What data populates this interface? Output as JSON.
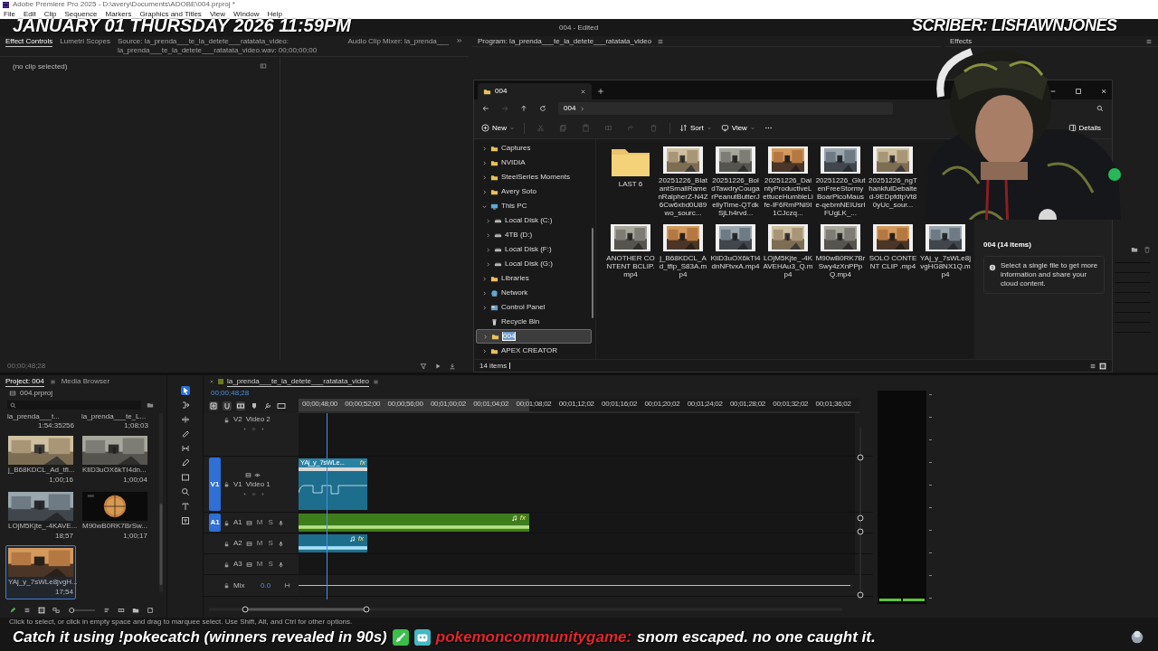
{
  "title_bar": {
    "title": "Adobe Premiere Pro 2025 - D:\\avery\\Documents\\ADOBE\\004.prproj *"
  },
  "menu": [
    "File",
    "Edit",
    "Clip",
    "Sequence",
    "Markers",
    "Graphics and Titles",
    "View",
    "Window",
    "Help"
  ],
  "overlay": {
    "date": "JANUARY 01 THURSDAY 2026 11:59PM",
    "subscriber": "SCRIBER: LISHAWNJONES"
  },
  "app_title": "004 - Edited",
  "source_panel": {
    "tabs": [
      {
        "label": "Effect Controls",
        "selected": true
      },
      {
        "label": "Lumetri Scopes",
        "selected": false
      },
      {
        "label": "Source: la_prenda___te_la_detete___ratatata_video: la_prenda___te_la_detete___ratatata_video.wav: 00;00;00;00",
        "selected": false
      },
      {
        "label": "Audio Clip Mixer: la_prenda___",
        "selected": false
      }
    ],
    "message": "(no clip selected)",
    "timecode": "00;00;48;28"
  },
  "program_panel": {
    "title": "Program: la_prenda___te_la_detete___ratatata_video"
  },
  "effects_panel": {
    "title": "Effects"
  },
  "explorer": {
    "tab_title": "004",
    "breadcrumb": "004",
    "forward_disabled": true,
    "toolbar": {
      "new": "New",
      "sort": "Sort",
      "view": "View",
      "details": "Details"
    },
    "actions": [
      {
        "kind": "cut",
        "disabled": true
      },
      {
        "kind": "copy",
        "disabled": true
      },
      {
        "kind": "paste",
        "disabled": true
      },
      {
        "kind": "rename",
        "disabled": true
      },
      {
        "kind": "share",
        "disabled": true
      },
      {
        "kind": "delete",
        "disabled": true
      }
    ],
    "nav": [
      {
        "label": "Captures",
        "kind": "folder",
        "expanded": false,
        "selected": false
      },
      {
        "label": "NVIDIA",
        "kind": "folder",
        "expanded": false,
        "selected": false
      },
      {
        "label": "SteelSeries Moments",
        "kind": "folder",
        "expanded": false,
        "selected": false
      },
      {
        "label": "Avery Soto",
        "kind": "folder",
        "expanded": false,
        "selected": false
      },
      {
        "label": "This PC",
        "kind": "pc",
        "expanded": true,
        "selected": false,
        "children": [
          {
            "label": "Local Disk (C:)",
            "kind": "drive",
            "expanded": false,
            "selected": false
          },
          {
            "label": "4TB (D:)",
            "kind": "drive",
            "expanded": false,
            "selected": false
          },
          {
            "label": "Local Disk (F:)",
            "kind": "drive",
            "expanded": false,
            "selected": false
          },
          {
            "label": "Local Disk (G:)",
            "kind": "drive",
            "expanded": false,
            "selected": false
          }
        ]
      },
      {
        "label": "Libraries",
        "kind": "folder",
        "expanded": false,
        "selected": false
      },
      {
        "label": "Network",
        "kind": "network",
        "expanded": false,
        "selected": false
      },
      {
        "label": "Control Panel",
        "kind": "control",
        "expanded": false,
        "selected": false
      },
      {
        "label": "Recycle Bin",
        "kind": "bin",
        "selected": false
      },
      {
        "label": "004",
        "kind": "folder",
        "expanded": false,
        "selected": true,
        "editing": true
      },
      {
        "label": "APEX CREATOR",
        "kind": "folder",
        "expanded": false,
        "selected": false
      }
    ],
    "files": [
      {
        "name": "LAST 6",
        "kind": "folder"
      },
      {
        "name": "20251226_BlatantSmallRamenRalpherZ-N4Z6Cw6xbd0U89wo_sourc...",
        "kind": "video"
      },
      {
        "name": "20251226_BoldTawdryCougarPeanutButterJellyTime-QTdkSjLh4rvd...",
        "kind": "video"
      },
      {
        "name": "20251226_DaintyProductiveLettuceHumbleLife-IF6RmPNi9I1CJczq...",
        "kind": "video"
      },
      {
        "name": "20251226_GlutenFreeStormyBoarPicoMause-qebmNEIUsrIFUgLK_...",
        "kind": "video"
      },
      {
        "name": "20251226_ngThankfulDebaited-9EDpfdtpVt80yUc_sour...",
        "kind": "video"
      },
      {
        "name": "ANOTHER CONTENT BCLIP.mp4",
        "kind": "video"
      },
      {
        "name": "j_B68KDCL_Ad_tfip_S83A.mp4",
        "kind": "video"
      },
      {
        "name": "KliD3uOX6kTI4dnNFtvxA.mp4",
        "kind": "video"
      },
      {
        "name": "LOjM5Kjte_-4KAVEHAu3_Q.mp4",
        "kind": "video"
      },
      {
        "name": "M90wB0RK7BrSwy4zXnPPpQ.mp4",
        "kind": "video"
      },
      {
        "name": "SOLO CONTENT CLIP .mp4",
        "kind": "video"
      },
      {
        "name": "YAj_y_7sWLe8jvgHG8NX1Q.mp4",
        "kind": "video"
      }
    ],
    "details": {
      "title": "004 (14 items)",
      "message": "Select a single file to get more information and share your cloud content."
    },
    "status": "14 items"
  },
  "project_panel": {
    "tabs": [
      {
        "label": "Project: 004",
        "selected": true
      },
      {
        "label": "Media Browser",
        "selected": false
      }
    ],
    "file": "004.prproj",
    "partial_items": [
      {
        "name": "la_prenda___t...",
        "duration": "1:54:35256"
      },
      {
        "name": "la_prenda___te_L...",
        "duration": "1;08;03"
      }
    ],
    "items": [
      {
        "name": "j_B68KDCL_Ad_tfl...",
        "duration": "1;00;16",
        "selected": false
      },
      {
        "name": "KllD3uOX6kTI4dn...",
        "duration": "1;00;04",
        "selected": false
      },
      {
        "name": "LOjM5Kjte_-4KAVE...",
        "duration": "18;57",
        "selected": false
      },
      {
        "name": "M90wB0RK7BrSw...",
        "duration": "1;00;17",
        "selected": false
      },
      {
        "name": "YAj_y_7sWLe8jvgH...",
        "duration": "17;54",
        "selected": true
      }
    ],
    "zoom": {
      "level": 0.05
    }
  },
  "timeline": {
    "sequence": "la_prenda___te_la_detete___ratatata_video",
    "timecode": "00;00;48;28",
    "ruler": [
      "00;00;48;00",
      "00;00;52;00",
      "00;00;56;00",
      "00;01;00;02",
      "00;01;04;02",
      "00;01;08;02",
      "00;01;12;02",
      "00;01;16;02",
      "00;01;20;02",
      "00;01;24;02",
      "00;01;28;02",
      "00;01;32;02",
      "00;01;36;02"
    ],
    "tracks": [
      {
        "kind": "video",
        "label": "V2",
        "name": "Video 2",
        "targeted": false
      },
      {
        "kind": "video",
        "label": "V1",
        "name": "Video 1",
        "targeted": true,
        "target": "V1",
        "clips": [
          {
            "name": "YAj_y_7sWLe...",
            "badge": "fx"
          }
        ]
      },
      {
        "kind": "audio",
        "label": "A1",
        "targeted": true,
        "target": "A1",
        "mute": "M",
        "solo": "S",
        "clips": [
          {
            "badge": "fx"
          }
        ]
      },
      {
        "kind": "audio",
        "label": "A2",
        "targeted": false,
        "mute": "M",
        "solo": "S",
        "clips": [
          {
            "badge": "fx"
          }
        ]
      },
      {
        "kind": "audio",
        "label": "A3",
        "targeted": false,
        "mute": "M",
        "solo": "S"
      },
      {
        "kind": "mix",
        "label": "Mix",
        "value": "0.0"
      }
    ]
  },
  "status_text": "Click to select, or click in empty space and drag to marquee select. Use Shift, Alt, and Ctrl for other options.",
  "ticker": {
    "prompt": "Catch it using !pokecatch (winners revealed in 90s)",
    "channel": "pokemoncommunitygame:",
    "message": "snom escaped. no one caught it."
  }
}
